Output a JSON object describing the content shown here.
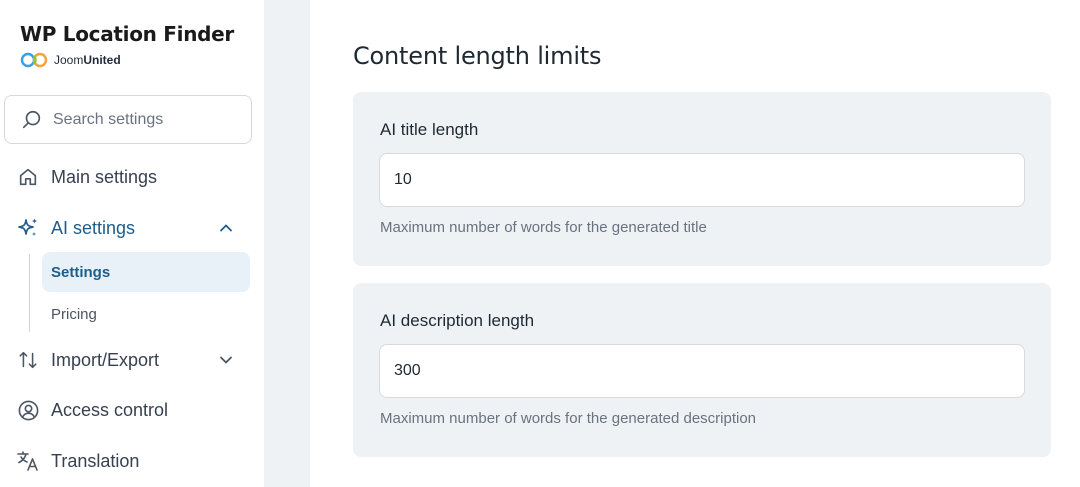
{
  "brand": {
    "title": "WP Location Finder",
    "maker_prefix": "Joom",
    "maker_bold": "United"
  },
  "search": {
    "placeholder": "Search settings"
  },
  "nav": {
    "main_settings": "Main settings",
    "ai_settings": "AI settings",
    "ai_sub": {
      "settings": "Settings",
      "pricing": "Pricing"
    },
    "import_export": "Import/Export",
    "access_control": "Access control",
    "translation": "Translation"
  },
  "icons": {
    "search": "search-icon",
    "home": "home-icon",
    "ai": "sparkles-icon",
    "import_export": "arrows-up-down-icon",
    "access": "user-circle-icon",
    "translation": "translate-icon"
  },
  "colors": {
    "accent": "#1f5d8b",
    "card_bg": "#eef2f5",
    "active_bg": "#e8f1f8"
  },
  "main": {
    "title": "Content length limits",
    "cards": [
      {
        "label": "AI title length",
        "value": "10",
        "help": "Maximum number of words for the generated title"
      },
      {
        "label": "AI description length",
        "value": "300",
        "help": "Maximum number of words for the generated description"
      }
    ]
  }
}
